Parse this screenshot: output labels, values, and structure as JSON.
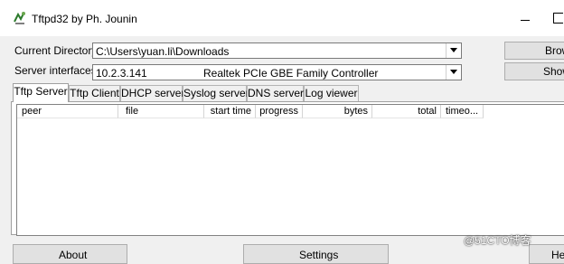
{
  "window": {
    "title": "Tftpd32 by Ph. Jounin",
    "icon": "tftpd-app-icon",
    "controls": {
      "minimize": "minimize-icon",
      "maximize": "maximize-icon"
    }
  },
  "current_directory": {
    "label": "Current Directory",
    "value": "C:\\Users\\yuan.li\\Downloads",
    "browse_label": "Brow"
  },
  "server_interfaces": {
    "label": "Server interfaces",
    "ip": "10.2.3.141",
    "adapter": "Realtek PCIe GBE Family Controller",
    "show_label": "Show"
  },
  "tabs": [
    {
      "label": "Tftp Server",
      "active": true
    },
    {
      "label": "Tftp Client",
      "active": false
    },
    {
      "label": "DHCP server",
      "active": false
    },
    {
      "label": "Syslog server",
      "active": false
    },
    {
      "label": "DNS server",
      "active": false
    },
    {
      "label": "Log viewer",
      "active": false
    }
  ],
  "table": {
    "columns": [
      "peer",
      "file",
      "start time",
      "progress",
      "bytes",
      "total",
      "timeo..."
    ],
    "rows": []
  },
  "bottom_buttons": {
    "about": "About",
    "settings": "Settings",
    "help": "He"
  },
  "watermark": "@51CTO博客"
}
